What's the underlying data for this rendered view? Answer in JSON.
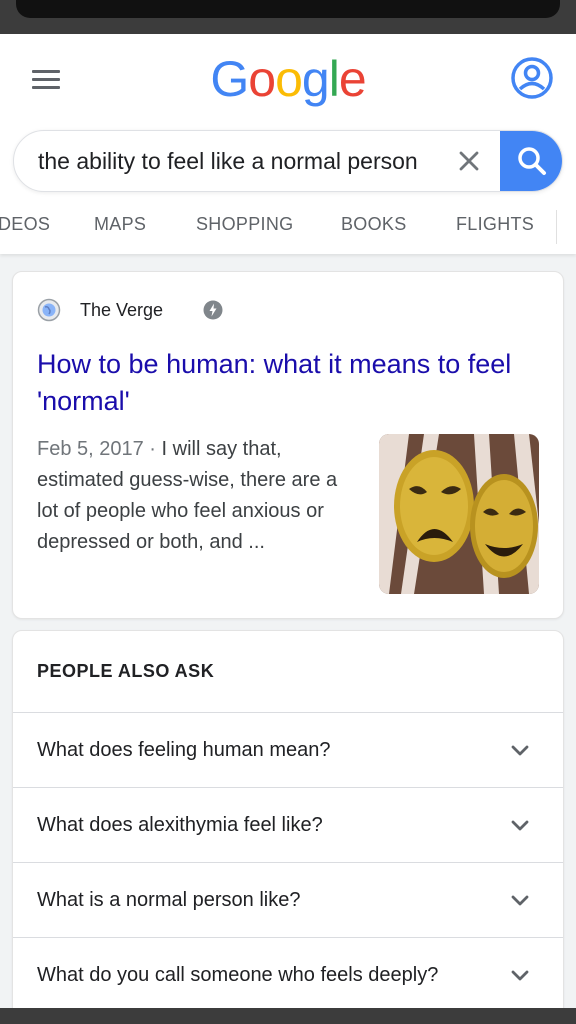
{
  "logo": {
    "letters": [
      "G",
      "o",
      "o",
      "g",
      "l",
      "e"
    ],
    "colors": [
      "#4285f4",
      "#ea4335",
      "#fbbc05",
      "#4285f4",
      "#34a853",
      "#ea4335"
    ]
  },
  "icons": {
    "menu": "hamburger-menu-icon",
    "account": "account-circle-icon",
    "clear": "close-icon",
    "search": "magnifier-icon",
    "source": "globe-icon",
    "amp": "amp-lightning-icon",
    "chevron": "chevron-down-icon"
  },
  "search": {
    "query": "the ability to feel like a normal person"
  },
  "tabs": [
    "DEOS",
    "MAPS",
    "SHOPPING",
    "BOOKS",
    "FLIGHTS"
  ],
  "result": {
    "source": "The Verge",
    "title": "How to be human: what it means to feel 'normal'",
    "date": "Feb 5, 2017",
    "separator": " · ",
    "snippet": "I will say that, estimated guess-wise, there are a lot of people who feel anxious or depressed or both, and ..."
  },
  "people_also_ask": {
    "heading": "PEOPLE ALSO ASK",
    "questions": [
      "What does feeling human mean?",
      "What does alexithymia feel like?",
      "What is a normal person like?",
      "What do you call someone who feels deeply?"
    ]
  },
  "colors": {
    "link": "#1a0dab",
    "accent": "#4285f4"
  }
}
